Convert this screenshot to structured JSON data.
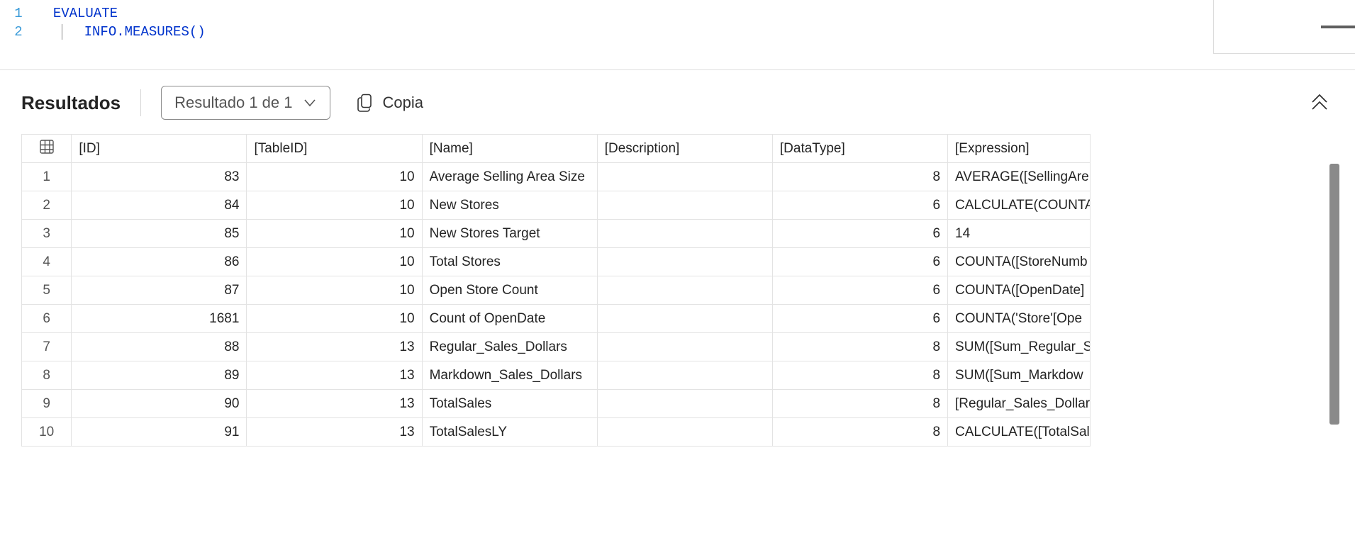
{
  "editor": {
    "lines": [
      {
        "num": "1",
        "kw": "EVALUATE",
        "rest": ""
      },
      {
        "num": "2",
        "indent": "    ",
        "fn": "INFO.MEASURES",
        "parens": "()"
      }
    ]
  },
  "results_bar": {
    "title": "Resultados",
    "selector_label": "Resultado 1 de 1",
    "copy_label": "Copia"
  },
  "grid": {
    "headers": {
      "id": "[ID]",
      "table_id": "[TableID]",
      "name": "[Name]",
      "description": "[Description]",
      "data_type": "[DataType]",
      "expression": "[Expression]"
    },
    "rows": [
      {
        "n": "1",
        "id": "83",
        "table_id": "10",
        "name": "Average Selling Area Size",
        "description": "",
        "data_type": "8",
        "expression": "AVERAGE([SellingAre"
      },
      {
        "n": "2",
        "id": "84",
        "table_id": "10",
        "name": "New Stores",
        "description": "",
        "data_type": "6",
        "expression": "CALCULATE(COUNTA"
      },
      {
        "n": "3",
        "id": "85",
        "table_id": "10",
        "name": "New Stores Target",
        "description": "",
        "data_type": "6",
        "expression": "14"
      },
      {
        "n": "4",
        "id": "86",
        "table_id": "10",
        "name": "Total Stores",
        "description": "",
        "data_type": "6",
        "expression": "COUNTA([StoreNumb"
      },
      {
        "n": "5",
        "id": "87",
        "table_id": "10",
        "name": "Open Store Count",
        "description": "",
        "data_type": "6",
        "expression": "COUNTA([OpenDate]"
      },
      {
        "n": "6",
        "id": "1681",
        "table_id": "10",
        "name": "Count of OpenDate",
        "description": "",
        "data_type": "6",
        "expression": "COUNTA('Store'[Ope"
      },
      {
        "n": "7",
        "id": "88",
        "table_id": "13",
        "name": "Regular_Sales_Dollars",
        "description": "",
        "data_type": "8",
        "expression": "SUM([Sum_Regular_S"
      },
      {
        "n": "8",
        "id": "89",
        "table_id": "13",
        "name": "Markdown_Sales_Dollars",
        "description": "",
        "data_type": "8",
        "expression": "SUM([Sum_Markdow"
      },
      {
        "n": "9",
        "id": "90",
        "table_id": "13",
        "name": "TotalSales",
        "description": "",
        "data_type": "8",
        "expression": "[Regular_Sales_Dollar"
      },
      {
        "n": "10",
        "id": "91",
        "table_id": "13",
        "name": "TotalSalesLY",
        "description": "",
        "data_type": "8",
        "expression": "CALCULATE([TotalSal"
      }
    ]
  }
}
